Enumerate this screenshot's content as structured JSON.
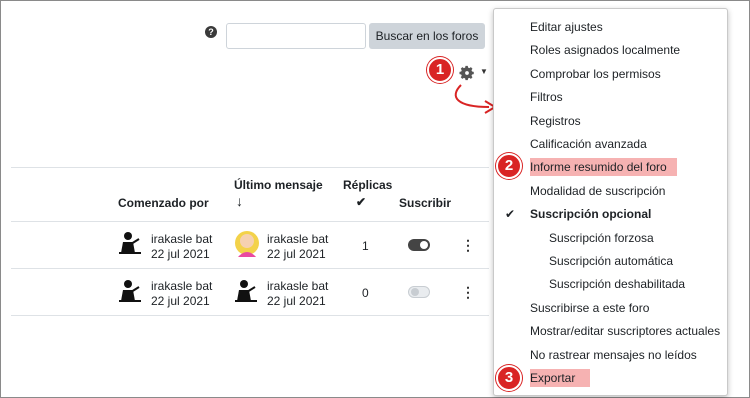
{
  "search": {
    "button_label": "Buscar en los foros",
    "help": "?"
  },
  "callouts": [
    "1",
    "2",
    "3"
  ],
  "table": {
    "headers": {
      "started_by": "Comenzado por",
      "last_post": "Último mensaje",
      "last_post_sort": "↓",
      "replies": "Réplicas",
      "replies_mark": "✔",
      "subscribe": "Suscribir"
    },
    "rows": [
      {
        "author": "irakasle bat",
        "author_date": "22 jul 2021",
        "last_author": "irakasle bat",
        "last_date": "22 jul 2021",
        "replies": "1",
        "subscribed": true
      },
      {
        "author": "irakasle bat",
        "author_date": "22 jul 2021",
        "last_author": "irakasle bat",
        "last_date": "22 jul 2021",
        "replies": "0",
        "subscribed": false
      }
    ],
    "kebab": "⋮"
  },
  "menu": {
    "items": [
      "Editar ajustes",
      "Roles asignados localmente",
      "Comprobar los permisos",
      "Filtros",
      "Registros",
      "Calificación avanzada",
      "Informe resumido del foro",
      "Modalidad de suscripción",
      "Suscripción opcional",
      "Suscripción forzosa",
      "Suscripción automática",
      "Suscripción deshabilitada",
      "Suscribirse a este foro",
      "Mostrar/editar suscriptores actuales",
      "No rastrear mensajes no leídos",
      "Exportar"
    ],
    "check": "✔"
  },
  "colors": {
    "highlight": "#f6b2b2",
    "callout": "#d92424"
  },
  "icons": [
    "help-icon",
    "gear-icon",
    "user-icon",
    "avatar",
    "toggle",
    "kebab-icon",
    "check-icon",
    "arrow-icon"
  ]
}
